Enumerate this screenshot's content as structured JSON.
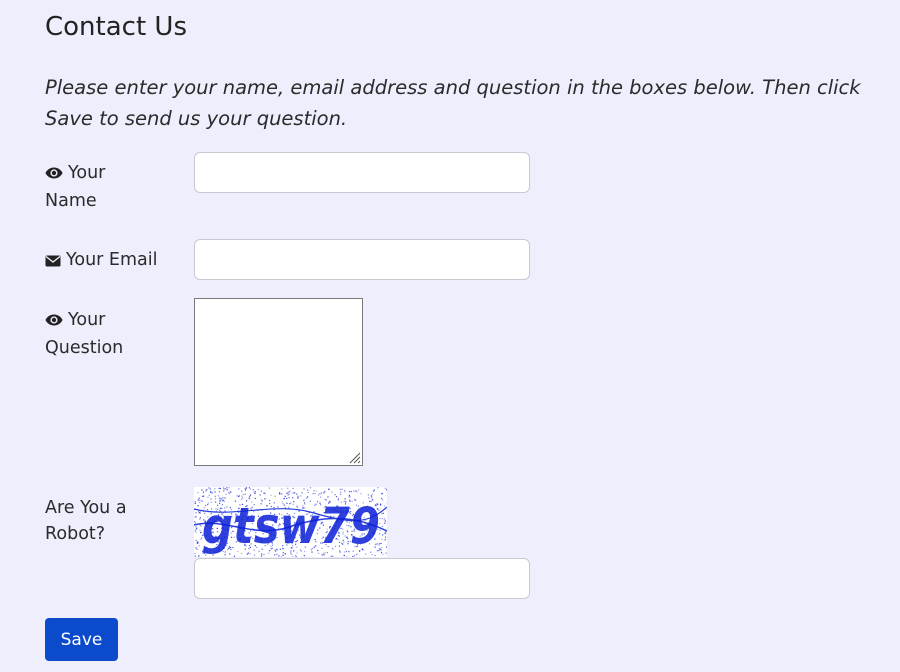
{
  "page": {
    "title": "Contact Us",
    "intro": "Please enter your name, email address and question in the boxes below. Then click Save to send us your question."
  },
  "form": {
    "name_label": "Your Name",
    "name_value": "",
    "email_label": "Your Email",
    "email_value": "",
    "question_label": "Your Question",
    "question_value": "",
    "robot_label": "Are You a Robot?",
    "captcha_text": "gtsw79",
    "captcha_answer": "",
    "save_label": "Save"
  },
  "icons": {
    "name_icon": "eye-icon",
    "email_icon": "envelope-icon",
    "question_icon": "eye-icon"
  },
  "colors": {
    "background": "#eeeefc",
    "button": "#0b4bcb",
    "captcha_ink": "#0a1fd6"
  }
}
